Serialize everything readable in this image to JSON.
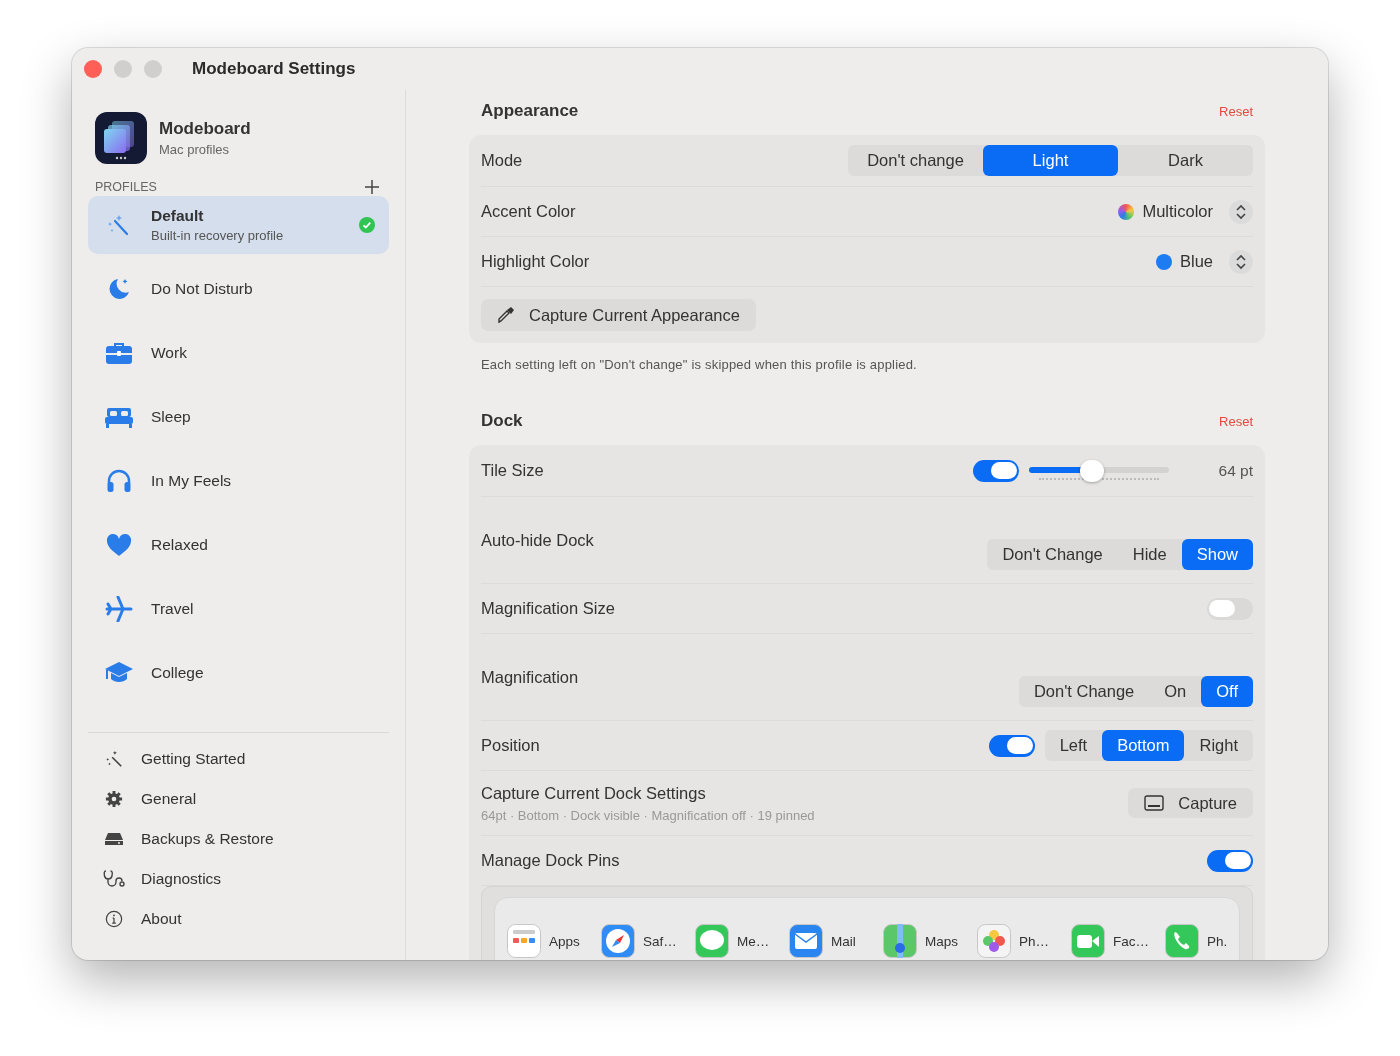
{
  "window": {
    "title": "Modeboard Settings"
  },
  "sidebar": {
    "app": {
      "name": "Modeboard",
      "subtitle": "Mac profiles"
    },
    "profiles_header": "PROFILES",
    "profiles": [
      {
        "name": "Default",
        "subtitle": "Built-in recovery profile",
        "selected": true,
        "active": true
      },
      {
        "name": "Do Not Disturb",
        "selected": false,
        "active": false
      },
      {
        "name": "Work",
        "selected": false,
        "active": false
      },
      {
        "name": "Sleep",
        "selected": false,
        "active": false
      },
      {
        "name": "In My Feels",
        "selected": false,
        "active": false
      },
      {
        "name": "Relaxed",
        "selected": false,
        "active": false
      },
      {
        "name": "Travel",
        "selected": false,
        "active": false
      },
      {
        "name": "College",
        "selected": false,
        "active": false
      }
    ],
    "footer": [
      "Getting Started",
      "General",
      "Backups & Restore",
      "Diagnostics",
      "About"
    ]
  },
  "appearance": {
    "title": "Appearance",
    "reset": "Reset",
    "rows": [
      {
        "kind": "segmented",
        "label": "Mode",
        "options": [
          {
            "label": "Don't change",
            "selected": false
          },
          {
            "label": "Light",
            "selected": true
          },
          {
            "label": "Dark",
            "selected": false
          }
        ]
      },
      {
        "kind": "popup",
        "label": "Accent Color",
        "value": "Multicolor"
      },
      {
        "kind": "popup",
        "label": "Highlight Color",
        "value": "Blue",
        "color": "#1e7cf2"
      }
    ],
    "capture_button": "Capture Current Appearance",
    "note": "Each setting left on \"Don't change\" is skipped when this profile is applied."
  },
  "dock": {
    "title": "Dock",
    "reset": "Reset",
    "rows": [
      {
        "kind": "slider",
        "label": "Tile Size",
        "on": true,
        "level": 0.45,
        "reading": "64 pt"
      },
      {
        "kind": "segmented",
        "label": "Auto-hide Dock",
        "options": [
          {
            "label": "Don't Change",
            "selected": false
          },
          {
            "label": "Hide",
            "selected": false
          },
          {
            "label": "Show",
            "selected": true
          }
        ]
      },
      {
        "kind": "toggle",
        "label": "Magnification Size",
        "on": false
      },
      {
        "kind": "segmented",
        "label": "Magnification",
        "options": [
          {
            "label": "Don't Change",
            "selected": false
          },
          {
            "label": "On",
            "selected": false
          },
          {
            "label": "Off",
            "selected": true
          }
        ]
      },
      {
        "kind": "segmented",
        "label": "Position",
        "on": true,
        "options": [
          {
            "label": "Left",
            "selected": false
          },
          {
            "label": "Bottom",
            "selected": true
          },
          {
            "label": "Right",
            "selected": false
          }
        ]
      },
      {
        "kind": "capture",
        "label": "Capture Current Dock Settings",
        "subtitle": "64pt · Bottom · Dock visible · Magnification off · 19 pinned",
        "button": "Capture"
      },
      {
        "kind": "toggle",
        "label": "Manage Dock Pins",
        "on": true
      }
    ],
    "pins": [
      "Apps",
      "Saf…",
      "Me…",
      "Mail",
      "Maps",
      "Ph…",
      "Fac…",
      "Ph."
    ]
  }
}
